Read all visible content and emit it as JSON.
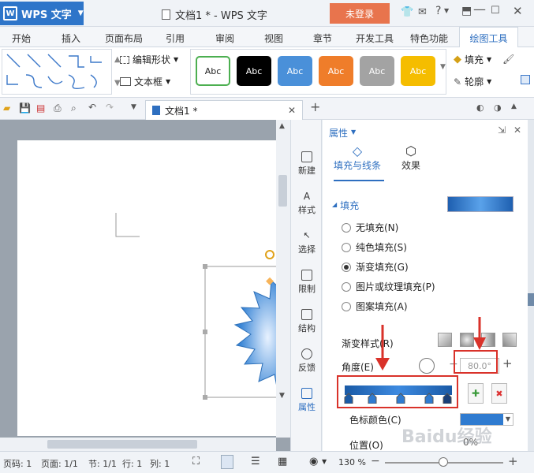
{
  "titlebar": {
    "app_name": "WPS 文字",
    "logo_letter": "W",
    "doc_title": "文档1 * - WPS 文字",
    "login_label": "未登录"
  },
  "ribbon_tabs": [
    "开始",
    "插入",
    "页面布局",
    "引用",
    "审阅",
    "视图",
    "章节",
    "开发工具",
    "特色功能",
    "绘图工具"
  ],
  "ribbon": {
    "edit_shape_label": "编辑形状",
    "textbox_label": "文本框",
    "style_label": "Abc",
    "fill_label": "填充",
    "outline_label": "轮廓"
  },
  "doc_tab": {
    "label": "文档1 *"
  },
  "sidebar": {
    "items": [
      "新建",
      "样式",
      "选择",
      "限制",
      "结构",
      "反馈",
      "属性"
    ]
  },
  "panel": {
    "header": "属性",
    "tabs": [
      "填充与线条",
      "效果"
    ],
    "fill_section": "填充",
    "options": [
      "无填充(N)",
      "纯色填充(S)",
      "渐变填充(G)",
      "图片或纹理填充(P)",
      "图案填充(A)"
    ],
    "selected_option": 2,
    "gradient_style_label": "渐变样式(R)",
    "angle_label": "角度(E)",
    "angle_value": "80.0°",
    "stop_color_label": "色标颜色(C)",
    "position_label": "位置(O)",
    "position_value": "0%"
  },
  "statusbar": {
    "page_num": "页码: 1",
    "pages": "页面: 1/1",
    "section": "节: 1/1",
    "row": "行: 1",
    "col": "列: 1",
    "zoom": "130 %"
  },
  "colors": {
    "accent": "#2e75c9",
    "login": "#e8744d",
    "highlight": "#d9322a",
    "shape_fill": "#3a86d6"
  },
  "watermark": "Baidu经验"
}
